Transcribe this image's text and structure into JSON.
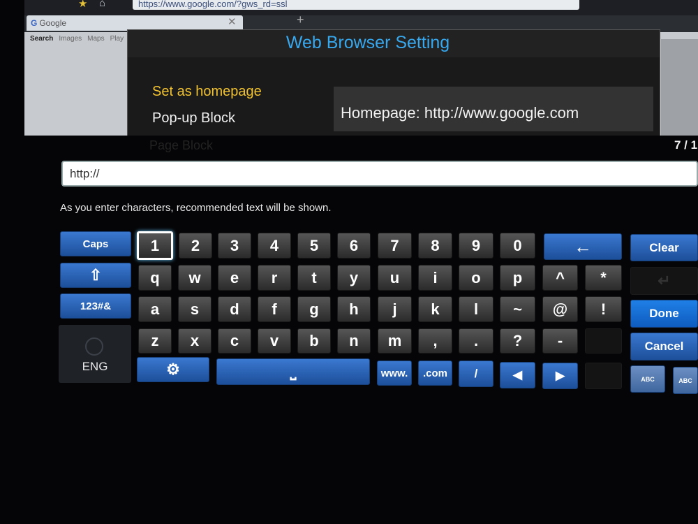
{
  "browser": {
    "url": "https://www.google.com/?gws_rd=ssl",
    "tab_title": "Google",
    "google_nav": [
      "Search",
      "Images",
      "Maps",
      "Play"
    ]
  },
  "dialog": {
    "title": "Web Browser Setting",
    "options": [
      "Set as homepage",
      "Pop-up Block"
    ],
    "homepage_value": "Homepage: http://www.google.com",
    "faded_item": "Page Block"
  },
  "keyboard": {
    "page_indicator": "7 / 1",
    "input_value": "http://",
    "hint": "As you enter characters, recommended text will be shown.",
    "left_keys": {
      "caps": "Caps",
      "shift": "⇧",
      "symbols": "123#&",
      "language": "ENG"
    },
    "row1": [
      "1",
      "2",
      "3",
      "4",
      "5",
      "6",
      "7",
      "8",
      "9",
      "0"
    ],
    "row2": [
      "q",
      "w",
      "e",
      "r",
      "t",
      "y",
      "u",
      "i",
      "o",
      "p",
      "^",
      "*"
    ],
    "row3": [
      "a",
      "s",
      "d",
      "f",
      "g",
      "h",
      "j",
      "k",
      "l",
      "~",
      "@",
      "!"
    ],
    "row4": [
      "z",
      "x",
      "c",
      "v",
      "b",
      "n",
      "m",
      ",",
      ".",
      "?",
      "-"
    ],
    "bottom": {
      "www": "www.",
      "com": ".com",
      "slash": "/",
      "left": "◀",
      "right": "▶",
      "space": "⎵",
      "settings": "⚙"
    },
    "backspace": "←",
    "right_keys": {
      "clear": "Clear",
      "enter": "↵",
      "done": "Done",
      "cancel": "Cancel",
      "abc1": "ABC",
      "abc2": "ABC"
    },
    "selected_key": "1"
  },
  "colors": {
    "accent": "#38a8ee",
    "highlight": "#f1c232",
    "key_blue": "#2a63b6"
  },
  "icons": [
    "star-icon",
    "home-icon",
    "close-icon",
    "plus-icon",
    "globe-icon",
    "settings-icon",
    "backspace-icon",
    "enter-icon",
    "arrow-left-icon",
    "arrow-right-icon",
    "shift-icon"
  ]
}
